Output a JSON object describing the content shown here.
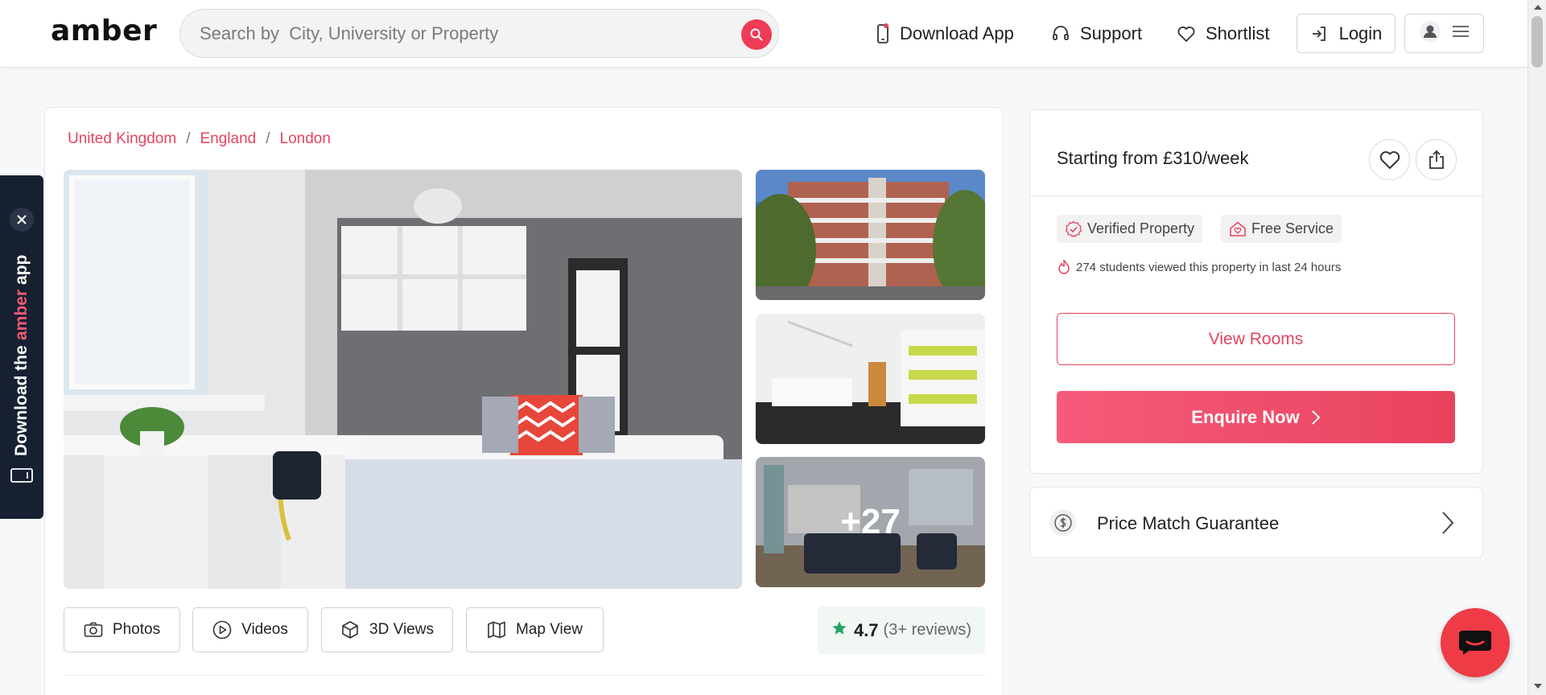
{
  "header": {
    "logo": "amber",
    "search_placeholder": "Search by  City, University or Property",
    "nav": {
      "download_app": "Download App",
      "support": "Support",
      "shortlist": "Shortlist",
      "login": "Login"
    }
  },
  "breadcrumb": [
    "United Kingdom",
    "England",
    "London"
  ],
  "gallery": {
    "more_count": "+27"
  },
  "media_buttons": {
    "photos": "Photos",
    "videos": "Videos",
    "views_3d": "3D Views",
    "map_view": "Map View"
  },
  "rating": {
    "score": "4.7",
    "reviews": "(3+ reviews)"
  },
  "side_panel": {
    "price_text": "Starting from £310/week",
    "tags": {
      "verified": "Verified Property",
      "free": "Free Service"
    },
    "viewed_text": "274 students viewed this property in last 24 hours",
    "view_rooms": "View Rooms",
    "enquire": "Enquire Now"
  },
  "price_match": {
    "label": "Price Match Guarantee"
  },
  "app_banner": {
    "prefix": "Download the",
    "brand": "amber",
    "suffix": "app"
  },
  "colors": {
    "accent": "#e5455e",
    "banner_bg": "#172031",
    "rating_star": "#23a565"
  },
  "icons": {
    "search": "search-icon",
    "phone": "phone-icon",
    "headset": "headset-icon",
    "heart": "heart-icon",
    "login": "login-icon",
    "user": "user-icon",
    "menu": "menu-icon",
    "camera": "camera-icon",
    "play": "play-icon",
    "cube": "cube-icon",
    "map": "map-icon",
    "star": "star-icon",
    "share": "share-icon",
    "verified": "verified-badge-icon",
    "home": "home-icon",
    "fire": "fire-icon",
    "chevron": "chevron-right-icon",
    "dollar": "dollar-icon",
    "close": "close-icon",
    "device": "device-icon",
    "chat": "chat-icon"
  }
}
